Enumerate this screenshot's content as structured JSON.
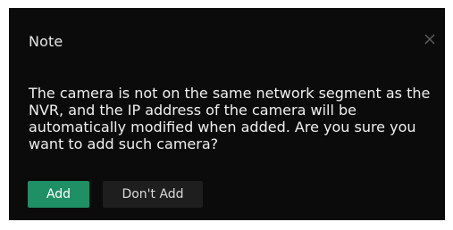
{
  "dialog": {
    "title": "Note",
    "close_icon": "close-icon",
    "message": "The camera is not on the same network segment as the NVR, and the IP address of the camera will be automatically modified when added. Are you sure you want to add such camera?",
    "buttons": {
      "add_label": "Add",
      "dont_add_label": "Don't Add"
    }
  },
  "colors": {
    "background": "#0b0b0b",
    "primary_button": "#1f8f66",
    "secondary_button": "#1e1e1e",
    "text": "#e6e6e6"
  }
}
